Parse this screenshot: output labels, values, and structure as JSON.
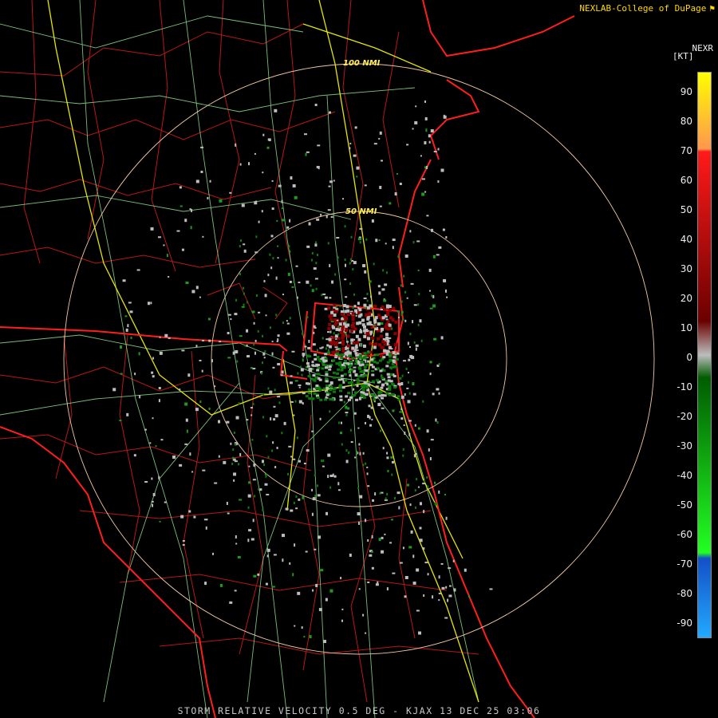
{
  "credit": {
    "text": "NEXLAB-College of DuPage",
    "flag_icon": "flag-icon"
  },
  "footer": {
    "caption": "STORM RELATIVE VELOCITY 0.5 DEG - KJAX 13 DEC 25 03:06"
  },
  "radar": {
    "site": "KJAX",
    "rings": [
      {
        "label": "100 NMI",
        "range_nmi": 100
      },
      {
        "label": "50 NMI",
        "range_nmi": 50
      }
    ]
  },
  "legend": {
    "product": "NEXR",
    "unit": "[KT]",
    "ticks": [
      "90",
      "80",
      "70",
      "60",
      "50",
      "40",
      "30",
      "20",
      "10",
      "0",
      "-10",
      "-20",
      "-30",
      "-40",
      "-50",
      "-60",
      "-70",
      "-80",
      "-90"
    ],
    "colors": {
      "yellow": "#ffff00",
      "orange": "#ff9a4a",
      "bright_red": "#ff1a1a",
      "dark_red": "#6b0000",
      "gray": "#bdbdbd",
      "dark_green": "#005c00",
      "bright_green": "#22ff22",
      "dark_blue": "#1250c8",
      "light_blue": "#22aaff"
    }
  },
  "map_colors": {
    "county_lines": "#c81e1e",
    "state_lines": "#ff2020",
    "highways": "#e6e600",
    "roads": "#a8f0a8",
    "rings": "#f0c8a0"
  }
}
